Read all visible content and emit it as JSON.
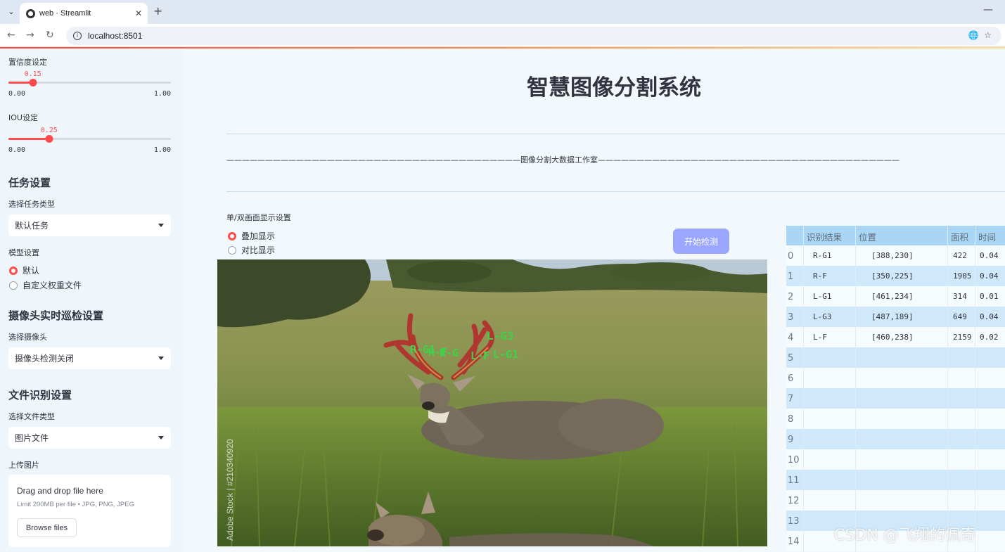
{
  "browser": {
    "tab_title": "web · Streamlit",
    "url": "localhost:8501"
  },
  "sidebar": {
    "confidence": {
      "label": "置信度设定",
      "value": "0.15",
      "value_num": 0.15,
      "min": "0.00",
      "max": "1.00"
    },
    "iou": {
      "label": "IOU设定",
      "value": "0.25",
      "value_num": 0.25,
      "min": "0.00",
      "max": "1.00"
    },
    "task": {
      "heading": "任务设置",
      "label": "选择任务类型",
      "selected": "默认任务"
    },
    "model": {
      "label": "模型设置",
      "options": [
        "默认",
        "自定义权重文件"
      ],
      "selected_index": 0
    },
    "camera": {
      "heading": "摄像头实时巡检设置",
      "label": "选择摄像头",
      "selected": "摄像头检测关闭"
    },
    "file": {
      "heading": "文件识别设置",
      "label": "选择文件类型",
      "selected": "图片文件"
    },
    "upload": {
      "label": "上传图片",
      "drop_text": "Drag and drop file here",
      "limit_text": "Limit 200MB per file • JPG, PNG, JPEG",
      "button": "Browse files"
    }
  },
  "main": {
    "title": "智慧图像分割系统",
    "subtitle_line": "——————————————————————————————————————图像分割大数据工作室———————————————————————————————————————",
    "display_mode": {
      "label": "单/双画面显示设置",
      "options": [
        "叠加显示",
        "对比显示"
      ],
      "selected_index": 0
    },
    "detect_button": "开始检测",
    "image": {
      "stock_watermark": "Adobe Stock | #210340920",
      "overlay_labels": [
        "R-G1",
        "R-F",
        "R-G",
        "L-G3",
        "L-G1",
        "L-F"
      ]
    },
    "table": {
      "columns": [
        "识别结果",
        "位置",
        "面积",
        "时间"
      ],
      "rows": [
        {
          "index": "0",
          "result": "R-G1",
          "position": "[388,230]",
          "area": "422",
          "time": "0.04"
        },
        {
          "index": "1",
          "result": "R-F",
          "position": "[350,225]",
          "area": "1905",
          "time": "0.04"
        },
        {
          "index": "2",
          "result": "L-G1",
          "position": "[461,234]",
          "area": "314",
          "time": "0.01"
        },
        {
          "index": "3",
          "result": "L-G3",
          "position": "[487,189]",
          "area": "649",
          "time": "0.04"
        },
        {
          "index": "4",
          "result": "L-F",
          "position": "[460,238]",
          "area": "2159",
          "time": "0.02"
        },
        {
          "index": "5"
        },
        {
          "index": "6"
        },
        {
          "index": "7"
        },
        {
          "index": "8"
        },
        {
          "index": "9"
        },
        {
          "index": "10"
        },
        {
          "index": "11"
        },
        {
          "index": "12"
        },
        {
          "index": "13"
        },
        {
          "index": "14"
        }
      ]
    }
  },
  "watermark": "CSDN @飞翔的佩奇"
}
